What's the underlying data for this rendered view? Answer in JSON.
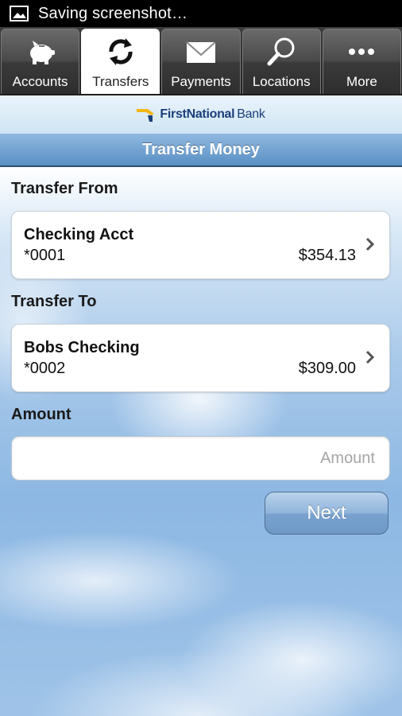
{
  "status_bar": {
    "text": "Saving screenshot…",
    "icon": "image-icon"
  },
  "tabs": [
    {
      "label": "Accounts",
      "icon": "piggy-bank-icon",
      "active": false
    },
    {
      "label": "Transfers",
      "icon": "transfer-arrows-icon",
      "active": true
    },
    {
      "label": "Payments",
      "icon": "envelope-icon",
      "active": false
    },
    {
      "label": "Locations",
      "icon": "magnifier-icon",
      "active": false
    },
    {
      "label": "More",
      "icon": "more-dots-icon",
      "active": false
    }
  ],
  "bank": {
    "name_bold": "FirstNational",
    "name_regular": "Bank"
  },
  "page_title": "Transfer Money",
  "transfer_from": {
    "label": "Transfer From",
    "account_name": "Checking Acct",
    "account_number": "*0001",
    "balance": "$354.13"
  },
  "transfer_to": {
    "label": "Transfer To",
    "account_name": "Bobs Checking",
    "account_number": "*0002",
    "balance": "$309.00"
  },
  "amount": {
    "label": "Amount",
    "placeholder": "Amount",
    "value": ""
  },
  "next_button": "Next",
  "colors": {
    "accent": "#6e98c6",
    "title_bar": "#5a8fc4",
    "tab_inactive": "#3a3a3a"
  }
}
